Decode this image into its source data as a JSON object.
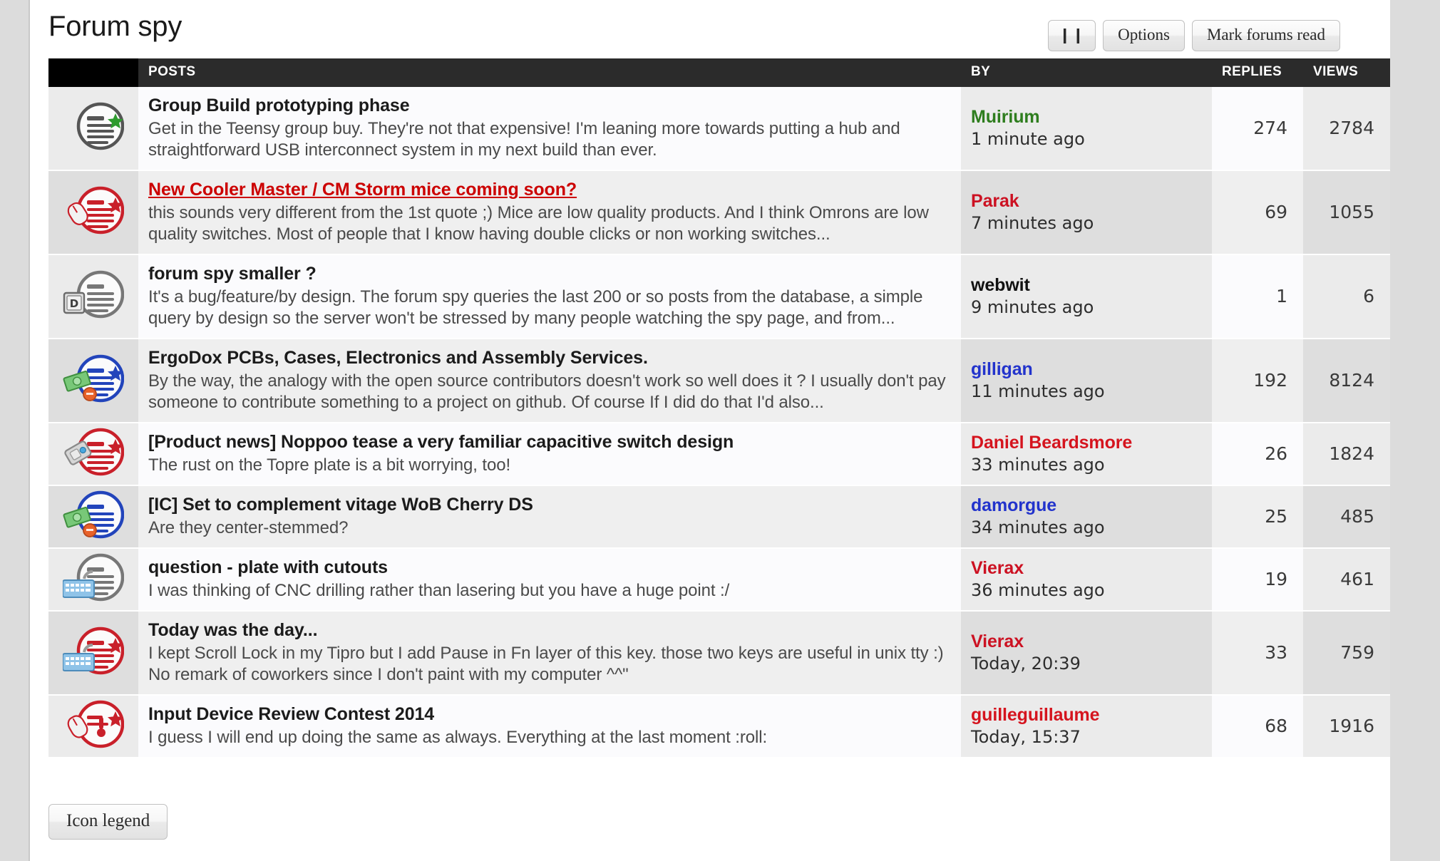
{
  "header": {
    "title": "Forum spy",
    "buttons": {
      "pause_label": "❙❙",
      "options_label": "Options",
      "mark_read_label": "Mark forums read"
    }
  },
  "table": {
    "columns": {
      "icon": "",
      "posts": "POSTS",
      "by": "BY",
      "replies": "REPLIES",
      "views": "VIEWS"
    },
    "rows": [
      {
        "icon": "magnifier-doc-star-green-icon",
        "title": "Group Build prototyping phase",
        "unread": false,
        "snippet": "Get in the Teensy group buy. They're not that expensive! I'm leaning more towards putting a hub and straightforward USB interconnect system in my next build than ever.",
        "author": "Muirium",
        "author_color": "#2e7d1e",
        "time": "1 minute ago",
        "replies": "274",
        "views": "2784"
      },
      {
        "icon": "magnifier-doc-star-red-mouse-icon",
        "title": "New Cooler Master / CM Storm mice coming soon?",
        "unread": true,
        "snippet": "this sounds very different from the 1st quote ;) Mice are low quality products. And I think Omrons are low quality switches. Most of people that I know having double clicks or non working switches...",
        "author": "Parak",
        "author_color": "#cc1122",
        "time": "7 minutes ago",
        "replies": "69",
        "views": "1055"
      },
      {
        "icon": "magnifier-doc-keycap-d-grey-icon",
        "title": "forum spy smaller ?",
        "unread": false,
        "snippet": "It's a bug/feature/by design. The forum spy queries the last 200 or so posts from the database, a simple query by design so the server won't be stressed by many people watching the spy page, and from...",
        "author": "webwit",
        "author_color": "#111111",
        "time": "9 minutes ago",
        "replies": "1",
        "views": "6"
      },
      {
        "icon": "magnifier-doc-star-blue-money-icon",
        "title": "ErgoDox PCBs, Cases, Electronics and Assembly Services.",
        "unread": false,
        "snippet": "By the way, the analogy with the open source contributors doesn't work so well does it ? I usually don't pay someone to contribute something to a project on github. Of course If I did do that I'd also...",
        "author": "gilligan",
        "author_color": "#2233cc",
        "time": "11 minutes ago",
        "replies": "192",
        "views": "8124"
      },
      {
        "icon": "magnifier-doc-star-red-switch-icon",
        "title": "[Product news] Noppoo tease a very familiar capacitive switch design",
        "unread": false,
        "snippet": "The rust on the Topre plate is a bit worrying, too!",
        "author": "Daniel Beardsmore",
        "author_color": "#d5141e",
        "time": "33 minutes ago",
        "replies": "26",
        "views": "1824"
      },
      {
        "icon": "magnifier-doc-blue-money-icon",
        "title": "[IC] Set to complement vitage WoB Cherry DS",
        "unread": false,
        "snippet": "Are they center-stemmed?",
        "author": "damorgue",
        "author_color": "#2233cc",
        "time": "34 minutes ago",
        "replies": "25",
        "views": "485"
      },
      {
        "icon": "magnifier-doc-keyboard-grey-icon",
        "title": "question - plate with cutouts",
        "unread": false,
        "snippet": "I was thinking of CNC drilling rather than lasering but you have a huge point :/",
        "author": "Vierax",
        "author_color": "#cc1122",
        "time": "36 minutes ago",
        "replies": "19",
        "views": "461"
      },
      {
        "icon": "magnifier-doc-star-red-keyboard-icon",
        "title": "Today was the day...",
        "unread": false,
        "snippet": "I kept Scroll Lock in my Tipro but I add Pause in Fn layer of this key. those two keys are useful in unix tty :) No remark of coworkers since I don't paint with my computer ^^\"",
        "author": "Vierax",
        "author_color": "#cc1122",
        "time": "Today, 20:39",
        "replies": "33",
        "views": "759"
      },
      {
        "icon": "magnifier-doc-star-red-bulb-icon",
        "title": "Input Device Review Contest 2014",
        "unread": false,
        "snippet": "I guess I will end up doing the same as always. Everything at the last moment :roll:",
        "author": "guilleguillaume",
        "author_color": "#d5141e",
        "time": "Today, 15:37",
        "replies": "68",
        "views": "1916"
      }
    ]
  },
  "footer": {
    "icon_legend_label": "Icon legend"
  },
  "colors": {
    "header_bar": "#2b2b2b",
    "unread_link": "#cc0000",
    "row_odd": "#fbfbfd",
    "row_even": "#efefef"
  }
}
